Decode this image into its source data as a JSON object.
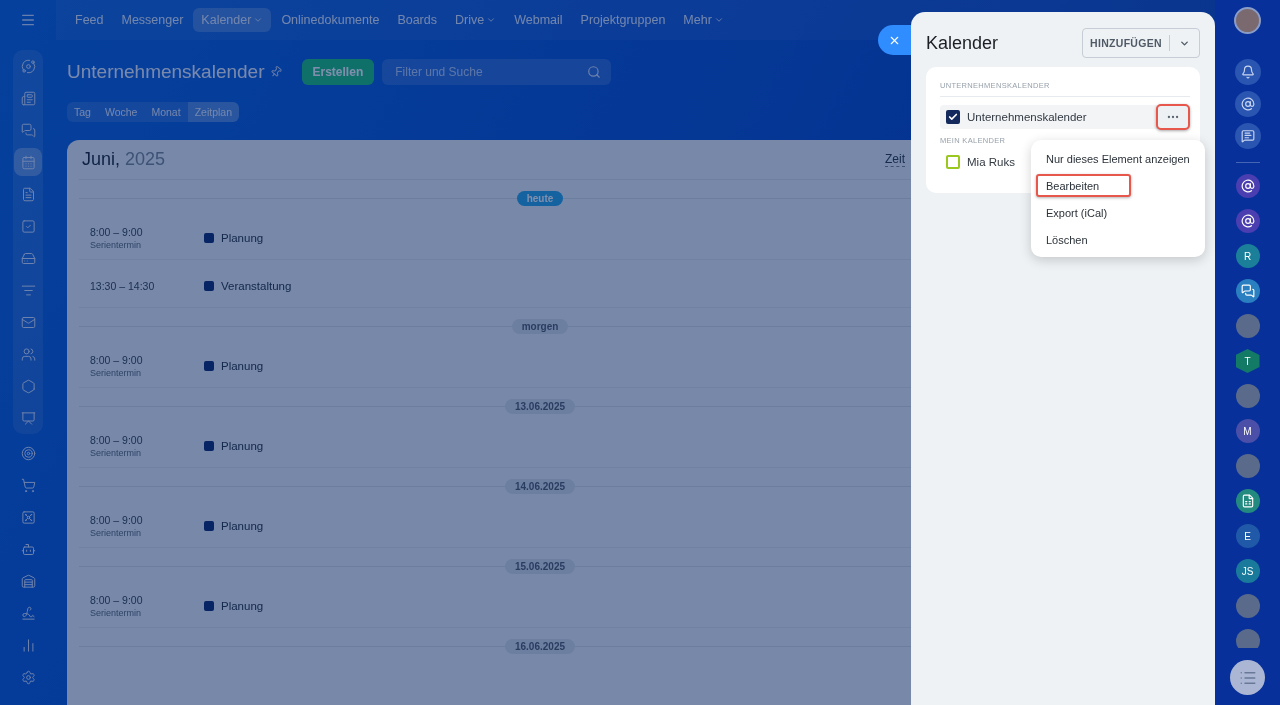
{
  "sidebar": {
    "items": [
      {
        "selected": false
      },
      {
        "selected": false
      },
      {
        "selected": false
      },
      {
        "selected": true
      },
      {
        "selected": false
      },
      {
        "selected": false
      },
      {
        "selected": false
      },
      {
        "selected": false
      },
      {
        "selected": false
      },
      {
        "selected": false
      },
      {
        "selected": false
      },
      {
        "selected": false
      },
      {
        "selected": false
      },
      {
        "selected": false
      },
      {
        "selected": false
      },
      {
        "selected": false
      },
      {
        "selected": false
      },
      {
        "selected": false
      },
      {
        "selected": false
      },
      {
        "selected": false
      }
    ]
  },
  "topnav": [
    {
      "label": "Feed",
      "selected": false,
      "dropdown": false
    },
    {
      "label": "Messenger",
      "selected": false,
      "dropdown": false
    },
    {
      "label": "Kalender",
      "selected": true,
      "dropdown": true
    },
    {
      "label": "Onlinedokumente",
      "selected": false,
      "dropdown": false
    },
    {
      "label": "Boards",
      "selected": false,
      "dropdown": false
    },
    {
      "label": "Drive",
      "selected": false,
      "dropdown": true
    },
    {
      "label": "Webmail",
      "selected": false,
      "dropdown": false
    },
    {
      "label": "Projektgruppen",
      "selected": false,
      "dropdown": false
    },
    {
      "label": "Mehr",
      "selected": false,
      "dropdown": true
    }
  ],
  "page": {
    "title": "Unternehmenskalender",
    "create_button": "Erstellen",
    "search": {
      "placeholder": "Filter und Suche"
    }
  },
  "views": [
    {
      "label": "Tag",
      "selected": false
    },
    {
      "label": "Woche",
      "selected": false
    },
    {
      "label": "Monat",
      "selected": false
    },
    {
      "label": "Zeitplan",
      "selected": true
    }
  ],
  "calendar": {
    "month": "Juni,",
    "year": "2025",
    "view_label": "Zeit",
    "days": [
      {
        "label": "heute",
        "today": true,
        "events": [
          {
            "time": "8:00 – 9:00",
            "note": "Serientermin",
            "title": "Planung"
          },
          {
            "time": "13:30 – 14:30",
            "title": "Veranstaltung"
          }
        ]
      },
      {
        "label": "morgen",
        "today": false,
        "events": [
          {
            "time": "8:00 – 9:00",
            "note": "Serientermin",
            "title": "Planung"
          }
        ]
      },
      {
        "label": "13.06.2025",
        "today": false,
        "events": [
          {
            "time": "8:00 – 9:00",
            "note": "Serientermin",
            "title": "Planung"
          }
        ]
      },
      {
        "label": "14.06.2025",
        "today": false,
        "events": [
          {
            "time": "8:00 – 9:00",
            "note": "Serientermin",
            "title": "Planung"
          }
        ]
      },
      {
        "label": "15.06.2025",
        "today": false,
        "events": [
          {
            "time": "8:00 – 9:00",
            "note": "Serientermin",
            "title": "Planung"
          }
        ]
      },
      {
        "label": "16.06.2025",
        "today": false
      }
    ]
  },
  "panel": {
    "title": "Kalender",
    "add_button": "HINZUFÜGEN",
    "sections": [
      {
        "label": "UNTERNEHMENSKALENDER",
        "calendars": [
          {
            "name": "Unternehmenskalender",
            "checked": true,
            "color": "#142a5c",
            "menu_highlighted": true
          }
        ]
      },
      {
        "label": "MEIN KALENDER",
        "calendars": [
          {
            "name": "Mia Ruks",
            "checked": false,
            "color": "#9bc81f"
          }
        ]
      }
    ],
    "menu": [
      {
        "label": "Nur dieses Element anzeigen",
        "highlighted": false
      },
      {
        "label": "Bearbeiten",
        "highlighted": true
      },
      {
        "label": "Export (iCal)",
        "highlighted": false
      },
      {
        "label": "Löschen",
        "highlighted": false
      }
    ]
  },
  "rightbar": {
    "items": [
      {
        "kind": "icon"
      },
      {
        "kind": "icon"
      },
      {
        "kind": "letter",
        "text": "R",
        "color": "#1b7f9a"
      },
      {
        "kind": "icon"
      },
      {
        "kind": "photo"
      },
      {
        "kind": "hex",
        "text": "T",
        "color": "#137a66"
      },
      {
        "kind": "photo"
      },
      {
        "kind": "letter",
        "text": "M",
        "color": "#4b4fa8"
      },
      {
        "kind": "photo"
      },
      {
        "kind": "icon"
      },
      {
        "kind": "letter",
        "text": "E",
        "color": "#2059a8"
      },
      {
        "kind": "letter",
        "text": "JS",
        "color": "#1a7a9b"
      },
      {
        "kind": "photo"
      },
      {
        "kind": "photo"
      }
    ]
  }
}
